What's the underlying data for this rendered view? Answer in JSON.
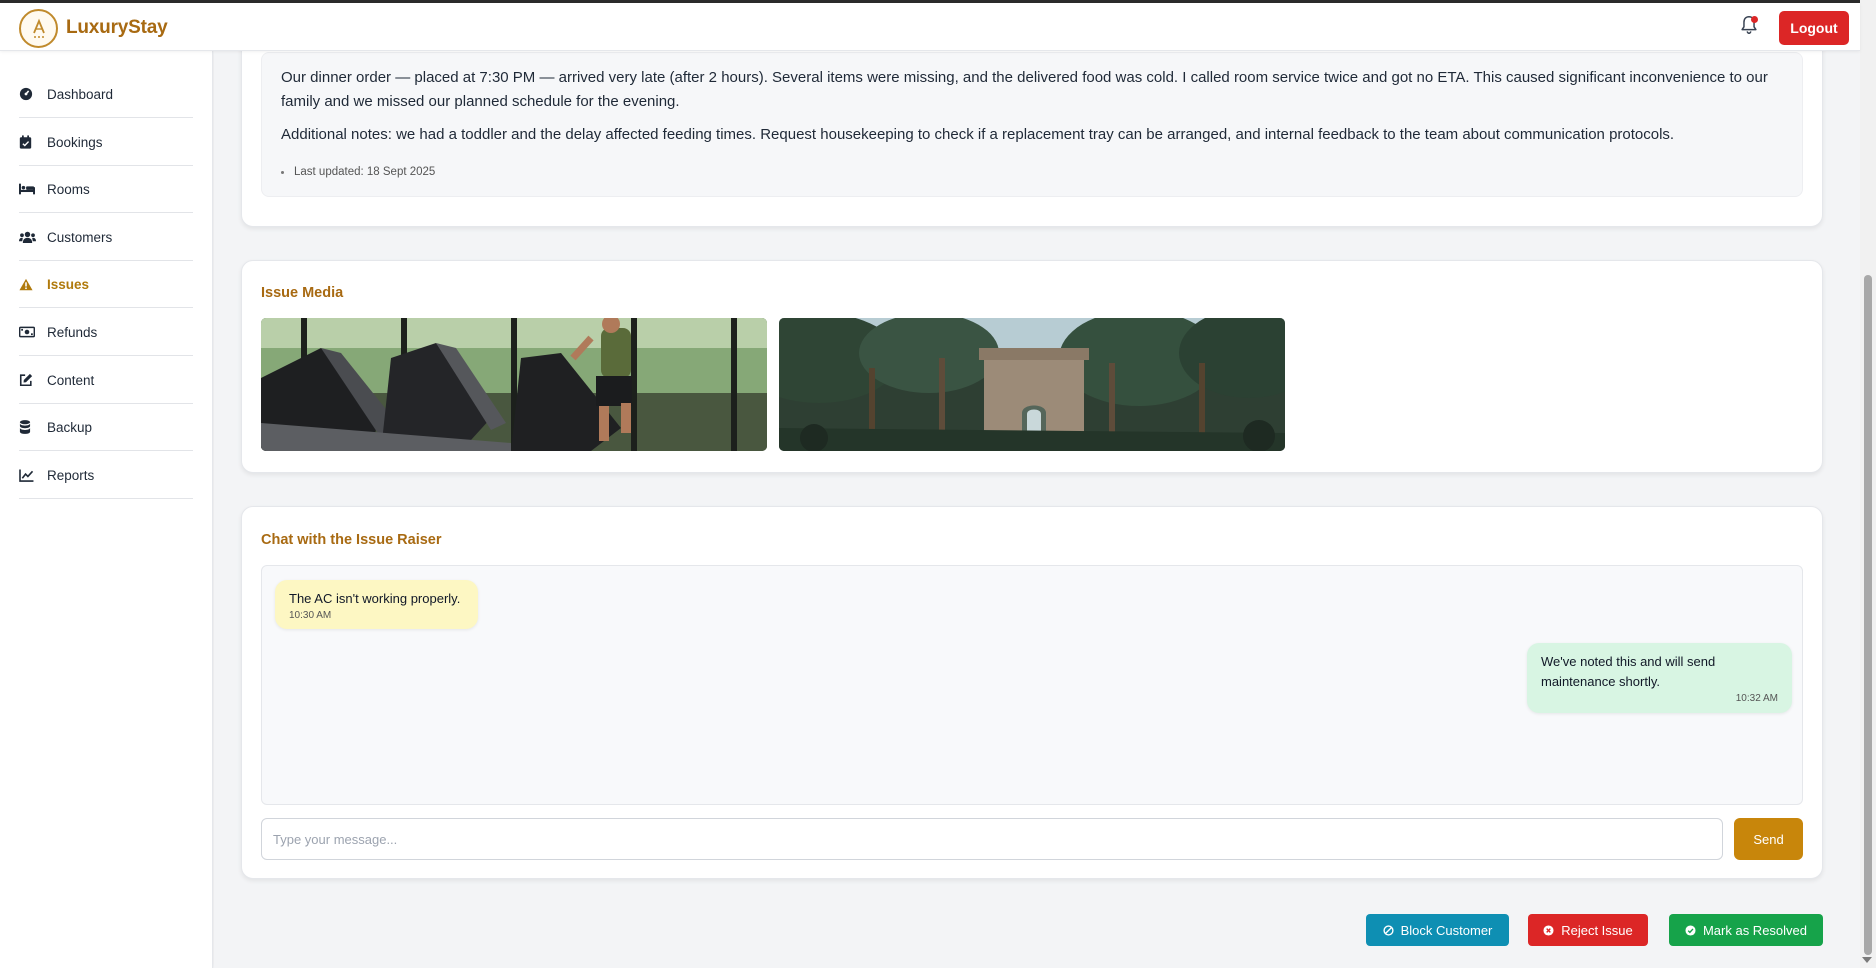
{
  "app": {
    "brand": "LuxuryStay"
  },
  "header": {
    "logout_label": "Logout",
    "has_notification": true
  },
  "sidebar": {
    "items": [
      {
        "label": "Dashboard",
        "icon": "gauge-icon",
        "active": false
      },
      {
        "label": "Bookings",
        "icon": "calendar-check-icon",
        "active": false
      },
      {
        "label": "Rooms",
        "icon": "bed-icon",
        "active": false
      },
      {
        "label": "Customers",
        "icon": "users-icon",
        "active": false
      },
      {
        "label": "Issues",
        "icon": "warning-triangle-icon",
        "active": true
      },
      {
        "label": "Refunds",
        "icon": "money-bill-icon",
        "active": false
      },
      {
        "label": "Content",
        "icon": "edit-icon",
        "active": false
      },
      {
        "label": "Backup",
        "icon": "database-icon",
        "active": false
      },
      {
        "label": "Reports",
        "icon": "line-chart-icon",
        "active": false
      }
    ]
  },
  "issue": {
    "description": "Our dinner order — placed at 7:30 PM — arrived very late (after 2 hours). Several items were missing, and the delivered food was cold. I called room service twice and got no ETA. This caused significant inconvenience to our family and we missed our planned schedule for the evening.",
    "additional_notes": "Additional notes: we had a toddler and the delay affected feeding times. Request housekeeping to check if a replacement tray can be arranged, and internal feedback to the team about communication protocols.",
    "last_updated": "Last updated: 18 Sept 2025"
  },
  "media": {
    "title": "Issue Media",
    "images": [
      {
        "alt": "gym treadmill photo"
      },
      {
        "alt": "palm garden building photo"
      }
    ]
  },
  "chat": {
    "title": "Chat with the Issue Raiser",
    "messages": [
      {
        "from": "raiser",
        "text": "The AC isn't working properly.",
        "time": "10:30 AM"
      },
      {
        "from": "admin",
        "text": "We've noted this and will send maintenance shortly.",
        "time": "10:32 AM"
      }
    ],
    "input_placeholder": "Type your message...",
    "send_label": "Send"
  },
  "actions": {
    "block_label": "Block Customer",
    "reject_label": "Reject Issue",
    "resolve_label": "Mark as Resolved"
  },
  "colors": {
    "brand": "#a86a12",
    "active_nav": "#b07a0c",
    "send": "#c8860b",
    "logout": "#dc2626",
    "block": "#0e8fb3",
    "reject": "#dc2626",
    "resolve": "#16a34a"
  }
}
